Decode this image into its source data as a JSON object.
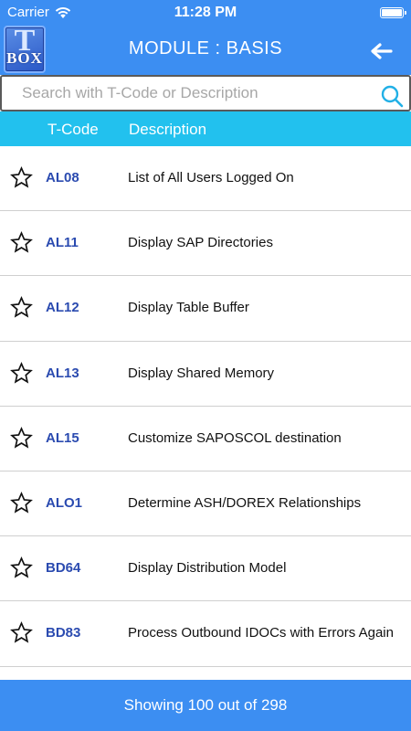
{
  "status_bar": {
    "carrier": "Carrier",
    "time": "11:28 PM"
  },
  "nav": {
    "logo_top": "T",
    "logo_bottom": "BOX",
    "title": "MODULE : BASIS",
    "back_icon": "arrow-left-icon"
  },
  "search": {
    "placeholder": "Search with T-Code or Description",
    "value": "",
    "icon": "search-icon"
  },
  "columns": {
    "tcode": "T-Code",
    "description": "Description"
  },
  "rows": [
    {
      "tcode": "AL08",
      "description": "List of All Users Logged On",
      "favorite": false
    },
    {
      "tcode": "AL11",
      "description": "Display SAP Directories",
      "favorite": false
    },
    {
      "tcode": "AL12",
      "description": "Display Table Buffer",
      "favorite": false
    },
    {
      "tcode": "AL13",
      "description": "Display Shared Memory",
      "favorite": false
    },
    {
      "tcode": "AL15",
      "description": "Customize SAPOSCOL destination",
      "favorite": false
    },
    {
      "tcode": "ALO1",
      "description": "Determine ASH/DOREX Relationships",
      "favorite": false
    },
    {
      "tcode": "BD64",
      "description": "Display Distribution Model",
      "favorite": false
    },
    {
      "tcode": "BD83",
      "description": "Process Outbound IDOCs with Errors Again",
      "favorite": false
    }
  ],
  "footer": {
    "text": "Showing 100 out of 298"
  },
  "colors": {
    "primary": "#3c8ef2",
    "header": "#22c1ee",
    "tcode": "#2b4bb0"
  }
}
